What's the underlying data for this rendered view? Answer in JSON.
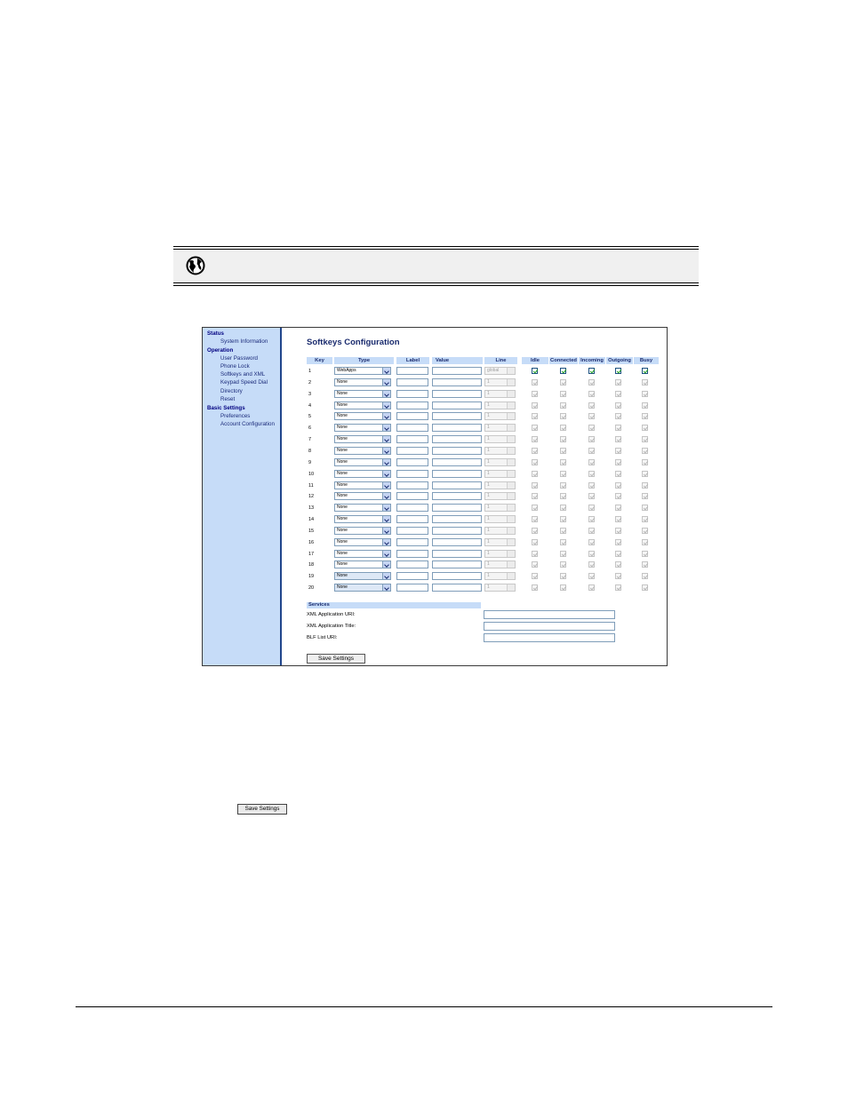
{
  "nav": {
    "status": "Status",
    "system_information": "System Information",
    "operation": "Operation",
    "user_password": "User Password",
    "phone_lock": "Phone Lock",
    "softkeys_xml": "Softkeys and XML",
    "keypad_speed_dial": "Keypad Speed Dial",
    "directory": "Directory",
    "reset": "Reset",
    "basic_settings": "Basic Settings",
    "preferences": "Preferences",
    "account_configuration": "Account Configuration"
  },
  "page_title": "Softkeys Configuration",
  "table": {
    "headers": {
      "key": "Key",
      "type": "Type",
      "label": "Label",
      "value": "Value",
      "line": "Line",
      "idle": "Idle",
      "connected": "Connected",
      "incoming": "Incoming",
      "outgoing": "Outgoing",
      "busy": "Busy"
    },
    "rows": [
      {
        "key": "1",
        "type": "WebApps",
        "line": "global",
        "enabled": true
      },
      {
        "key": "2",
        "type": "None",
        "line": "1",
        "enabled": false
      },
      {
        "key": "3",
        "type": "None",
        "line": "1",
        "enabled": false
      },
      {
        "key": "4",
        "type": "None",
        "line": "1",
        "enabled": false
      },
      {
        "key": "5",
        "type": "None",
        "line": "1",
        "enabled": false
      },
      {
        "key": "6",
        "type": "None",
        "line": "1",
        "enabled": false
      },
      {
        "key": "7",
        "type": "None",
        "line": "1",
        "enabled": false
      },
      {
        "key": "8",
        "type": "None",
        "line": "1",
        "enabled": false
      },
      {
        "key": "9",
        "type": "None",
        "line": "1",
        "enabled": false
      },
      {
        "key": "10",
        "type": "None",
        "line": "1",
        "enabled": false
      },
      {
        "key": "11",
        "type": "None",
        "line": "1",
        "enabled": false
      },
      {
        "key": "12",
        "type": "None",
        "line": "1",
        "enabled": false
      },
      {
        "key": "13",
        "type": "None",
        "line": "1",
        "enabled": false
      },
      {
        "key": "14",
        "type": "None",
        "line": "1",
        "enabled": false
      },
      {
        "key": "15",
        "type": "None",
        "line": "1",
        "enabled": false
      },
      {
        "key": "16",
        "type": "None",
        "line": "1",
        "enabled": false
      },
      {
        "key": "17",
        "type": "None",
        "line": "1",
        "enabled": false
      },
      {
        "key": "18",
        "type": "None",
        "line": "1",
        "enabled": false
      },
      {
        "key": "19",
        "type": "None",
        "line": "1",
        "enabled": false
      },
      {
        "key": "20",
        "type": "None",
        "line": "1",
        "enabled": false
      }
    ]
  },
  "services": {
    "header": "Services",
    "xml_app_uri": "XML Application URI:",
    "xml_app_title": "XML Application Title:",
    "blf_list_uri": "BLF List URI:"
  },
  "save_settings": "Save Settings",
  "colors": {
    "sidebar_bg": "#c6dcf8",
    "header_bg": "#c6dcf8",
    "title": "#1a2b6e"
  }
}
